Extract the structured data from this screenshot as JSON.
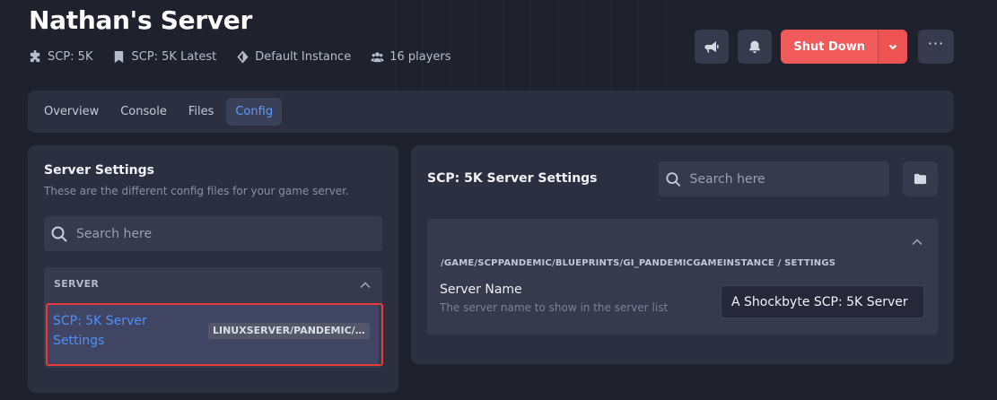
{
  "server": {
    "title": "Nathan's Server",
    "meta": {
      "game": "SCP: 5K",
      "version": "SCP: 5K Latest",
      "instance": "Default Instance",
      "players": "16 players"
    }
  },
  "actions": {
    "shutdown_label": "Shut Down",
    "more_label": "···"
  },
  "tabs": [
    {
      "label": "Overview"
    },
    {
      "label": "Console"
    },
    {
      "label": "Files"
    },
    {
      "label": "Config"
    }
  ],
  "left_panel": {
    "title": "Server Settings",
    "subtitle": "These are the different config files for your game server.",
    "search_placeholder": "Search here",
    "group": {
      "header": "SERVER",
      "item": {
        "label": "SCP: 5K Server Settings",
        "path": "LINUXSERVER/PANDEMIC/..."
      }
    }
  },
  "right_panel": {
    "title": "SCP: 5K Server Settings",
    "search_placeholder": "Search here",
    "section_path": "/GAME/SCPPANDEMIC/BLUEPRINTS/GI_PANDEMICGAMEINSTANCE / SETTINGS",
    "field": {
      "name": "Server Name",
      "description": "The server name to show in the server list",
      "value": "A Shockbyte SCP: 5K Server"
    }
  },
  "colors": {
    "background": "#1f212d",
    "panel": "#2c2f3f",
    "accent": "#5b9bff",
    "danger": "#f05a5a",
    "highlight_border": "#e83a3a"
  }
}
